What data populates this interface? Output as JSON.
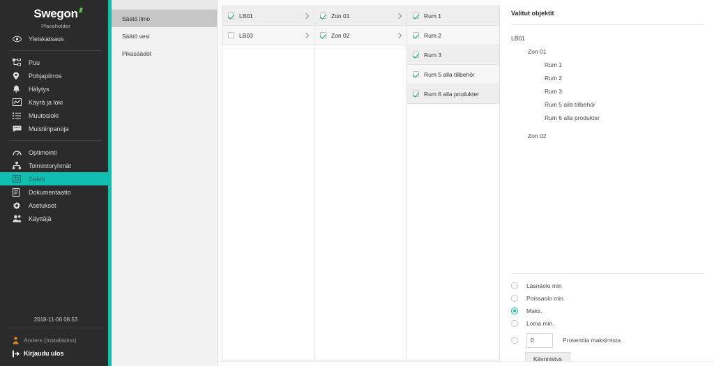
{
  "sidebar": {
    "brand": "Swegon",
    "brand_sub": "Placeholder",
    "overview": {
      "label": "Yleiskatsaus",
      "icon": "eye-icon"
    },
    "group1": [
      {
        "label": "Puu",
        "icon": "tree-icon"
      },
      {
        "label": "Pohjapiirros",
        "icon": "map-pin-icon"
      },
      {
        "label": "Hälytys",
        "icon": "bell-icon"
      },
      {
        "label": "Käyrä ja loki",
        "icon": "chart-line-icon"
      },
      {
        "label": "Muutosloki",
        "icon": "list-icon"
      },
      {
        "label": "Muistiinpanoja",
        "icon": "comment-icon"
      }
    ],
    "group2": [
      {
        "label": "Optimointi",
        "icon": "gauge-icon",
        "active": false
      },
      {
        "label": "Toimintoryhmät",
        "icon": "sitemap-icon",
        "active": false
      },
      {
        "label": "Säätö",
        "icon": "sliders-icon",
        "active": true
      },
      {
        "label": "Dokumentaatio",
        "icon": "document-icon",
        "active": false
      },
      {
        "label": "Asetukset",
        "icon": "gear-icon",
        "active": false
      },
      {
        "label": "Käyttäjä",
        "icon": "users-icon",
        "active": false
      }
    ],
    "datetime": "2018-11-06 08.53",
    "user": {
      "label": "Anders (Installation)",
      "icon": "user-icon"
    },
    "logout": {
      "label": "Kirjaudu ulos",
      "icon": "logout-icon"
    },
    "accent_color": "#10bfb0"
  },
  "submenu": {
    "items": [
      {
        "label": "Säätö ilmo",
        "active": true
      },
      {
        "label": "Säätö vesi",
        "active": false
      },
      {
        "label": "Pikasäädöt",
        "active": false
      }
    ]
  },
  "columns": [
    {
      "name": "unit-column",
      "rows": [
        {
          "label": "LB01",
          "checked": true,
          "chevron": true
        },
        {
          "label": "LB03",
          "checked": false,
          "chevron": true
        }
      ]
    },
    {
      "name": "zone-column",
      "rows": [
        {
          "label": "Zon 01",
          "checked": true,
          "chevron": true
        },
        {
          "label": "Zon 02",
          "checked": true,
          "chevron": true
        }
      ]
    },
    {
      "name": "room-column",
      "rows": [
        {
          "label": "Rum 1",
          "checked": true,
          "chevron": false
        },
        {
          "label": "Rum 2",
          "checked": true,
          "chevron": false
        },
        {
          "label": "Rum 3",
          "checked": true,
          "chevron": false
        },
        {
          "label": "Rum 5 alla tillbehör",
          "checked": true,
          "chevron": false
        },
        {
          "label": "Rum 6 alla produkter",
          "checked": true,
          "chevron": false
        }
      ]
    }
  ],
  "right": {
    "title": "Valitut objektit",
    "tree": [
      {
        "label": "LB01",
        "level": 0
      },
      {
        "label": "Zon 01",
        "level": 1
      },
      {
        "label": "Rum 1",
        "level": 2
      },
      {
        "label": "Rum 2",
        "level": 2
      },
      {
        "label": "Rum 3",
        "level": 2
      },
      {
        "label": "Rum 5 alla tillbehör",
        "level": 2
      },
      {
        "label": "Rum 6 alla produkter",
        "level": 2
      },
      {
        "label": "",
        "level": 0
      },
      {
        "label": "Zon 02",
        "level": 1
      }
    ],
    "radios": [
      {
        "label": "Läsnäolo min",
        "selected": false
      },
      {
        "label": "Poissaolo min.",
        "selected": false
      },
      {
        "label": "Maks.",
        "selected": true
      },
      {
        "label": "Loma min.",
        "selected": false
      }
    ],
    "percent": {
      "radio_selected": false,
      "value": "0",
      "label": "Prosenttia maksimista"
    },
    "start_button": "Käynnistys"
  }
}
